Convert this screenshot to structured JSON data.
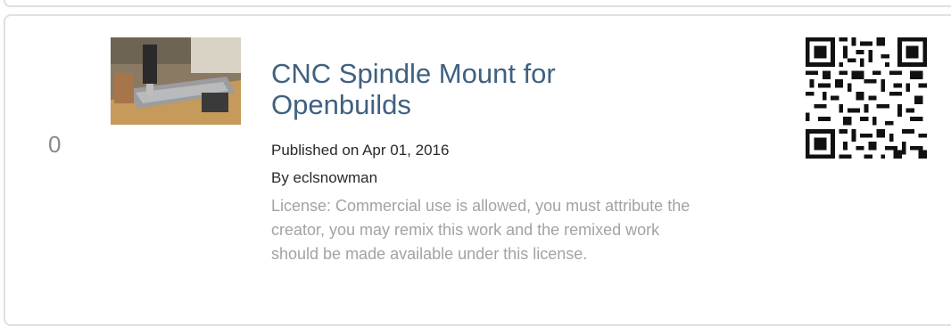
{
  "item": {
    "index": "0",
    "title": "CNC Spindle Mount for Openbuilds",
    "published": "Published on Apr 01, 2016",
    "author": "By eclsnowman",
    "license": "License: Commercial use is allowed, you must attribute the creator, you may remix this work and the remixed work should be made available under this license."
  },
  "colors": {
    "title": "#3f6180",
    "license": "#a3a3a3",
    "border": "#e0e0e0"
  }
}
